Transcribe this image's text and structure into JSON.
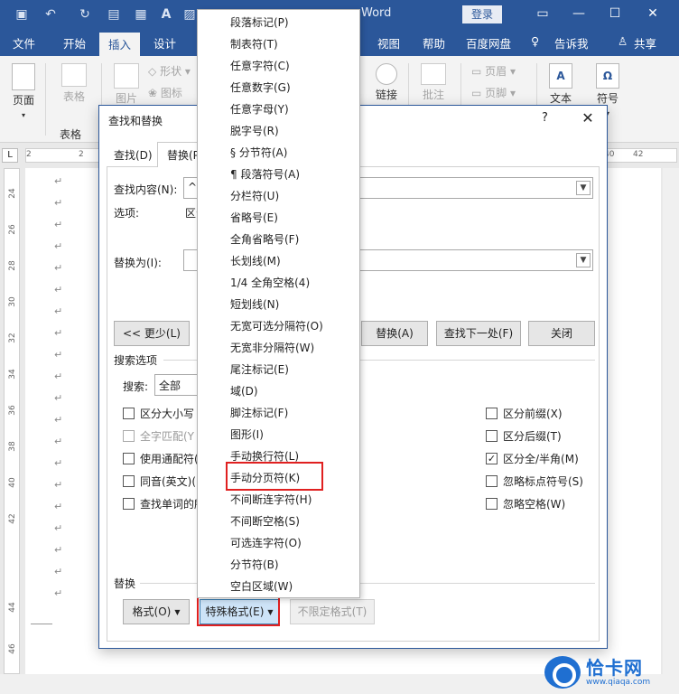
{
  "titlebar": {
    "title_left": "",
    "title": "Word",
    "login_label": "登录",
    "window_controls": [
      "—",
      "☐",
      "✕"
    ]
  },
  "ribbon_tabs": [
    {
      "label": "文件"
    },
    {
      "label": "开始"
    },
    {
      "label": "插入",
      "active": true
    },
    {
      "label": "设计"
    },
    {
      "label": "视图"
    },
    {
      "label": "帮助"
    },
    {
      "label": "百度网盘"
    },
    {
      "label": "告诉我"
    },
    {
      "label": "共享"
    }
  ],
  "ribbon": {
    "page_label": "页面",
    "table_label": "表格",
    "table_group": "表格",
    "picture_label": "图片",
    "shapes_label": "形状",
    "icons_label": "图标",
    "link_label": "链接",
    "comment_label": "批注",
    "header_label": "页眉",
    "footer_label": "页脚",
    "text_label": "文本",
    "symbol_label": "符号"
  },
  "ruler": {
    "corner": "L",
    "top_left": [
      "2",
      "2"
    ],
    "top_right": [
      "40",
      "42"
    ],
    "vertical": [
      "24",
      "26",
      "28",
      "30",
      "32",
      "34",
      "36",
      "38",
      "40",
      "42",
      "44",
      "46"
    ]
  },
  "page": {
    "pilcrow": "↵"
  },
  "dialog": {
    "title": "查找和替换",
    "help": "?",
    "close": "✕",
    "tab_find": "查找(D)",
    "tab_replace": "替换(P",
    "find_label": "查找内容(N):",
    "find_value": "^n",
    "options_label": "选项:",
    "options_value": "区分",
    "replace_label": "替换为(I):",
    "replace_value": "",
    "less_button": "<< 更少(L)",
    "replace_all_button": "替换(A)",
    "find_next_button": "查找下一处(F)",
    "close_button": "关闭",
    "search_options_heading": "搜索选项",
    "search_label": "搜索:",
    "search_value": "全部",
    "left_checks": [
      {
        "label": "区分大小写",
        "checked": false,
        "disabled": false
      },
      {
        "label": "全字匹配(Y",
        "checked": false,
        "disabled": true
      },
      {
        "label": "使用通配符(U",
        "checked": false,
        "disabled": false
      },
      {
        "label": "同音(英文)(K",
        "checked": false,
        "disabled": false
      },
      {
        "label": "查找单词的所",
        "checked": false,
        "disabled": false
      }
    ],
    "right_checks": [
      {
        "label": "区分前缀(X)",
        "checked": false
      },
      {
        "label": "区分后缀(T)",
        "checked": false
      },
      {
        "label": "区分全/半角(M)",
        "checked": true
      },
      {
        "label": "忽略标点符号(S)",
        "checked": false
      },
      {
        "label": "忽略空格(W)",
        "checked": false
      }
    ],
    "replace_heading": "替换",
    "format_button": "格式(O)",
    "special_button": "特殊格式(E)",
    "no_format_button": "不限定格式(T)"
  },
  "special_menu": [
    "段落标记(P)",
    "制表符(T)",
    "任意字符(C)",
    "任意数字(G)",
    "任意字母(Y)",
    "脱字号(R)",
    "§ 分节符(A)",
    "¶ 段落符号(A)",
    "分栏符(U)",
    "省略号(E)",
    "全角省略号(F)",
    "长划线(M)",
    "1/4 全角空格(4)",
    "短划线(N)",
    "无宽可选分隔符(O)",
    "无宽非分隔符(W)",
    "尾注标记(E)",
    "域(D)",
    "脚注标记(F)",
    "图形(I)",
    "手动换行符(L)",
    "手动分页符(K)",
    "不间断连字符(H)",
    "不间断空格(S)",
    "可选连字符(O)",
    "分节符(B)",
    "空白区域(W)"
  ],
  "watermark": {
    "name": "恰卡网",
    "url": "www.qiaqa.com"
  },
  "colors": {
    "accent": "#2b579a",
    "highlight_box": "#e02020",
    "watermark": "#1f6fd1"
  }
}
